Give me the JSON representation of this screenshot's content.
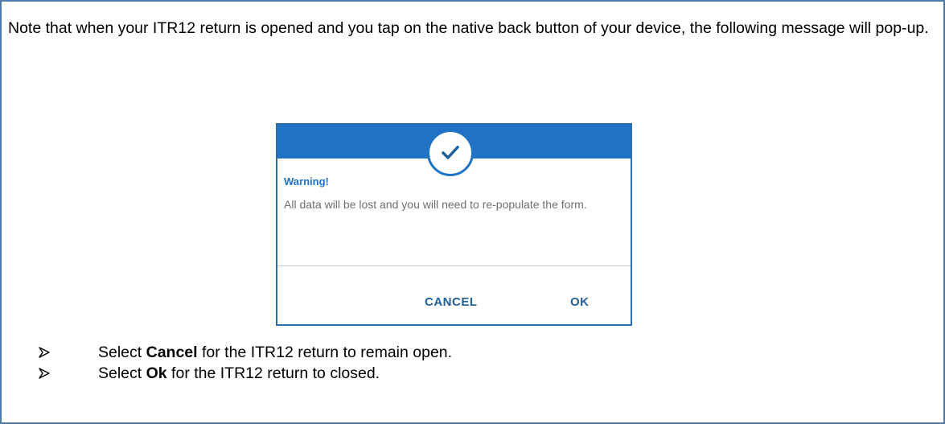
{
  "intro": {
    "text": "Note that when your ITR12 return is opened and you tap on the native back button of your device, the following message will pop-up."
  },
  "dialog": {
    "icon": "check-icon",
    "title": "Warning!",
    "message": "All data will be lost and you will need to re-populate the form.",
    "cancel_label": "CANCEL",
    "ok_label": "OK",
    "colors": {
      "header": "#1f72c4",
      "button_text": "#1f5f99",
      "message_text": "#6f6f6f"
    }
  },
  "bullets": [
    {
      "prefix": "Select ",
      "bold": "Cancel",
      "suffix": " for the ITR12 return to remain open."
    },
    {
      "prefix": "Select ",
      "bold": "Ok",
      "suffix": " for the ITR12 return to closed."
    }
  ],
  "bullet_icon": "arrow-bullet-icon",
  "border_color": "#4f7bab"
}
